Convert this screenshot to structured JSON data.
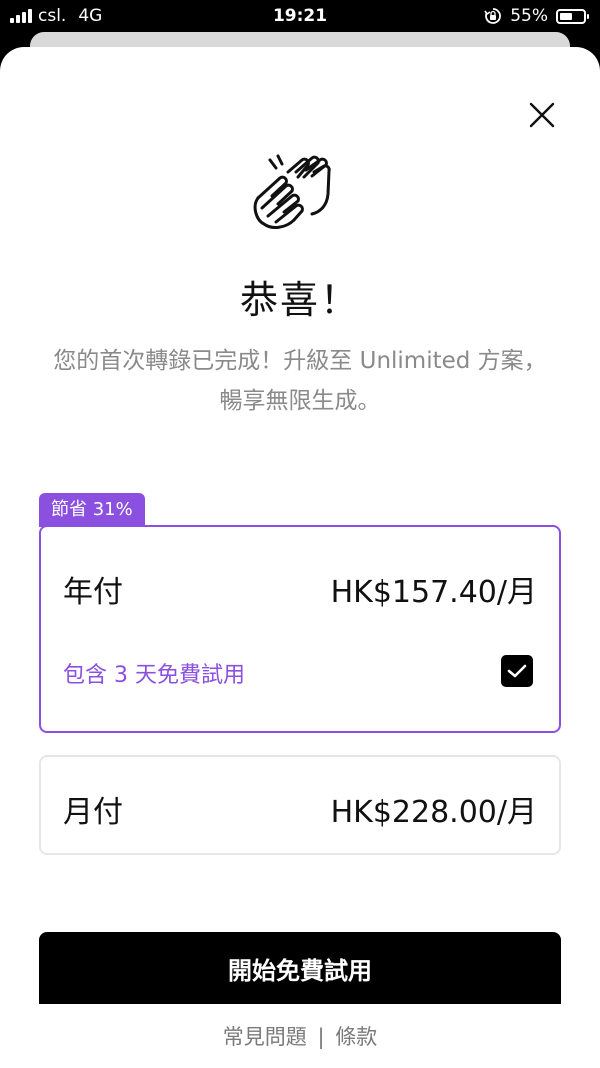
{
  "status_bar": {
    "carrier": "csl.",
    "network": "4G",
    "time": "19:21",
    "battery_percent_label": "55%",
    "battery_level": 0.55
  },
  "header": {
    "title": "恭喜！",
    "subtitle": "您的首次轉錄已完成！升級至 Unlimited 方案，暢享無限生成。"
  },
  "plans": {
    "save_badge": "節省 31%",
    "annual": {
      "name": "年付",
      "price": "HK$157.40/月",
      "trial": "包含 3 天免費試用",
      "trial_checked": true
    },
    "monthly": {
      "name": "月付",
      "price": "HK$228.00/月"
    }
  },
  "cta": {
    "label": "開始免費試用"
  },
  "footer": {
    "faq": "常見問題",
    "separator": "|",
    "terms": "條款"
  },
  "colors": {
    "accent": "#8b50e0",
    "text": "#111111",
    "muted": "#8a8a8a"
  },
  "icons": {
    "close": "close-icon",
    "header": "clapping-hands-icon",
    "check": "checkmark-icon"
  }
}
